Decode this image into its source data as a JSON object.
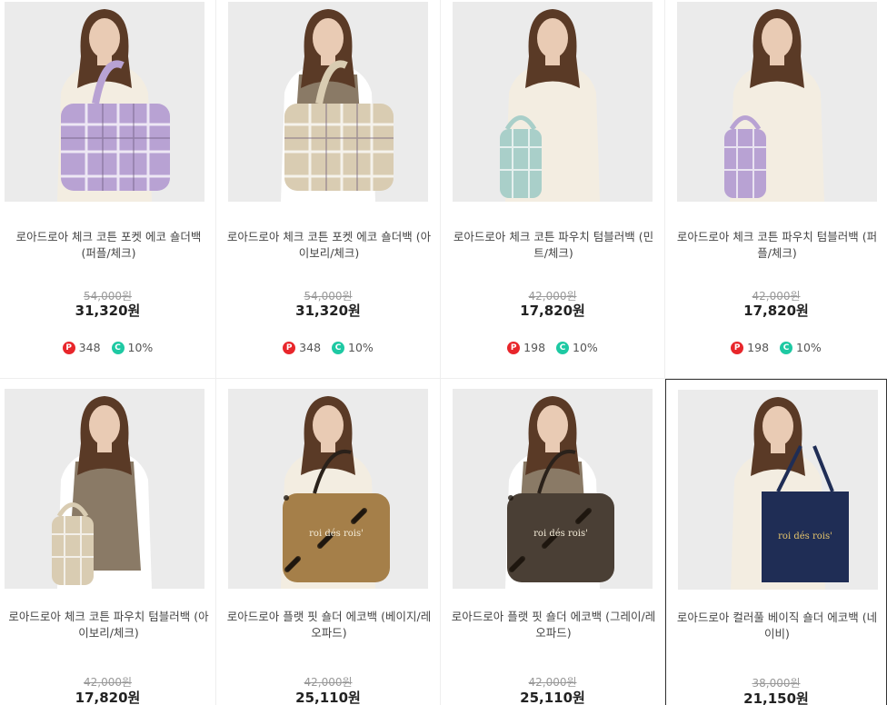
{
  "products": [
    {
      "name": "로아드로아 체크 코튼 포켓 에코 숄더백 (퍼플/체크)",
      "original_price": "54,000원",
      "sale_price": "31,320원",
      "points": "348",
      "coupon": "10%",
      "bag_color": "#b8a2d3",
      "bag_style": "plaid-tote"
    },
    {
      "name": "로아드로아 체크 코튼 포켓 에코 숄더백 (아이보리/체크)",
      "original_price": "54,000원",
      "sale_price": "31,320원",
      "points": "348",
      "coupon": "10%",
      "bag_color": "#d9ccb2",
      "bag_style": "plaid-tote"
    },
    {
      "name": "로아드로아 체크 코튼 파우치 텀블러백 (민트/체크)",
      "original_price": "42,000원",
      "sale_price": "17,820원",
      "points": "198",
      "coupon": "10%",
      "bag_color": "#a9cfc9",
      "bag_style": "pouch"
    },
    {
      "name": "로아드로아 체크 코튼 파우치 텀블러백 (퍼플/체크)",
      "original_price": "42,000원",
      "sale_price": "17,820원",
      "points": "198",
      "coupon": "10%",
      "bag_color": "#b8a2d3",
      "bag_style": "pouch"
    },
    {
      "name": "로아드로아 체크 코튼 파우치 텀블러백 (아이보리/체크)",
      "original_price": "42,000원",
      "sale_price": "17,820원",
      "bag_color": "#d9ccb2",
      "bag_style": "pouch"
    },
    {
      "name": "로아드로아 플랫 핏 숄더 에코백 (베이지/레오파드)",
      "original_price": "42,000원",
      "sale_price": "25,110원",
      "bag_color": "#a57f49",
      "bag_style": "leopard",
      "bag_print": "roi dés rois'"
    },
    {
      "name": "로아드로아 플랫 핏 숄더 에코백 (그레이/레오파드)",
      "original_price": "42,000원",
      "sale_price": "25,110원",
      "bag_color": "#4a3f35",
      "bag_style": "leopard",
      "bag_print": "roi dés rois'"
    },
    {
      "name": "로아드로아 컬러풀 베이직 숄더 에코백 (네이비)",
      "original_price": "38,000원",
      "sale_price": "21,150원",
      "bag_color": "#1f2d55",
      "bag_style": "solid",
      "bag_print": "roi dés rois'"
    }
  ],
  "badge_labels": {
    "points": "P",
    "coupon": "C"
  },
  "selected_index": 7
}
